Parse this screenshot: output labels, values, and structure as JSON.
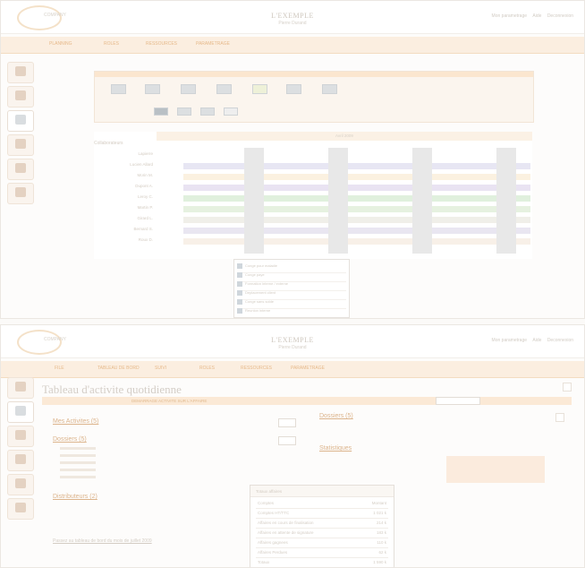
{
  "shot1": {
    "header": {
      "logo_text": "COMPANY",
      "title": "L'EXEMPLE",
      "subtitle": "Pierre Durand",
      "links": [
        "Mon parametrage",
        "Aide",
        "Deconnexion"
      ]
    },
    "tabs": [
      "PLANNING",
      "ROLES",
      "RESSOURCES",
      "PARAMETRAGE"
    ],
    "sidebar": [
      "home",
      "stats",
      "planning",
      "documents",
      "notes",
      "buildings"
    ],
    "planning": {
      "month_label": "Avril 2009",
      "left_header": "Collaborateurs",
      "rows": [
        "Lapierre",
        "Lucien Allard",
        "Morin M.",
        "Dupont A.",
        "Leroy C.",
        "Martin P.",
        "Girard L.",
        "Bernard S.",
        "Roux D."
      ],
      "popup_items": [
        "Conge pour maladie",
        "Conge paye",
        "Formation interne / externe",
        "Deplacement client",
        "Conge sans solde",
        "Reunion interne"
      ]
    }
  },
  "shot2": {
    "header": {
      "logo_text": "COMPANY",
      "title": "L'EXEMPLE",
      "subtitle": "Pierre Durand",
      "links": [
        "Mon parametrage",
        "Aide",
        "Deconnexion"
      ]
    },
    "tabs": [
      "FILE",
      "TABLEAU DE BORD",
      "SUIVI",
      "ROLES",
      "RESSOURCES",
      "PARAMETRAGE"
    ],
    "page_title": "Tableau d'activite quotidienne",
    "banner": "DEMARRAGE ACTIVITE SUR L'AFFAIRE",
    "left": {
      "section1": "Mes Activites (5)",
      "section2": "Dossiers (5)",
      "section3": "Distributeurs (2)",
      "footer_link": "Passez au tableau de bord du mois de juillet 2009"
    },
    "right": {
      "section1": "Dossiers (5)",
      "section2": "Statistiques"
    },
    "info_popup": {
      "title": "Totaux affaires",
      "rows": [
        [
          "Comptes",
          "Montant"
        ],
        [
          "Comptes HT/TTC",
          "1 021 k"
        ],
        [
          "Affaires en cours de finalisation",
          "214 k"
        ],
        [
          "Affaires en attente de signature",
          "183 k"
        ],
        [
          "Affaires gagnees",
          "110 k"
        ],
        [
          "Affaires Perdues",
          "62 k"
        ],
        [
          "Totaux",
          "1 590 k"
        ]
      ]
    }
  }
}
